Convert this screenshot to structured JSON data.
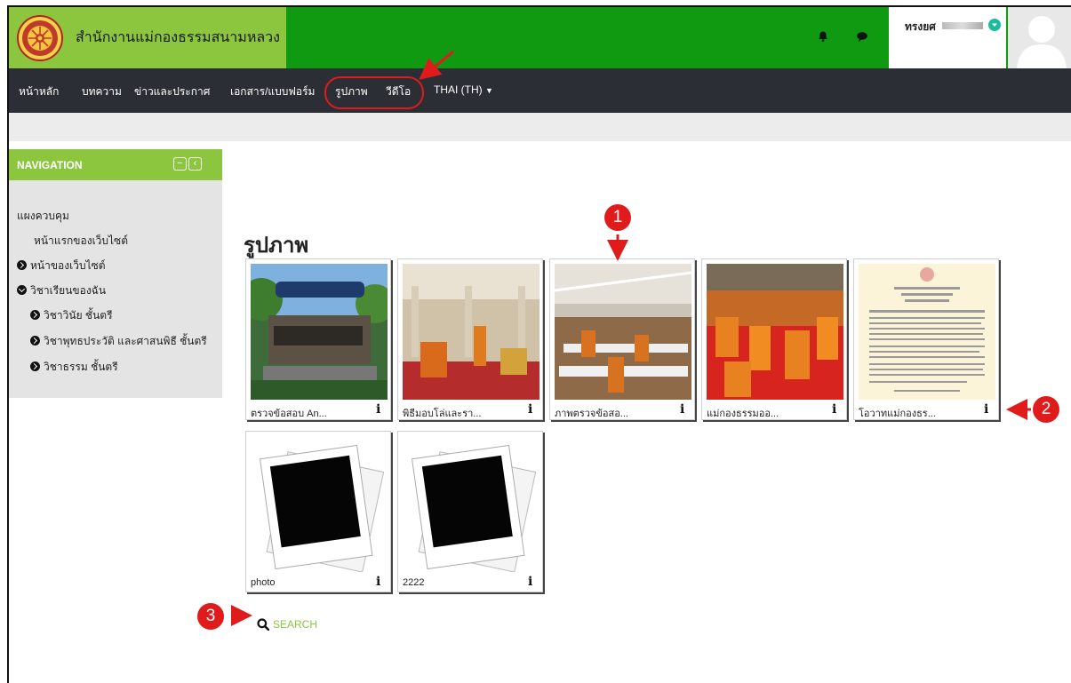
{
  "header": {
    "site_title": "สำนักงานแม่กองธรรมสนามหลวง",
    "user_name": "ทรงยศ",
    "colors": {
      "brand_green": "#8cc63f",
      "header_green": "#0f9a12",
      "navbar": "#2b2f35"
    },
    "icons": [
      "seal-logo-icon",
      "bell-icon",
      "chat-icon",
      "user-status-icon",
      "avatar-icon"
    ]
  },
  "nav": {
    "items": [
      "หน้าหลัก",
      "บทความ",
      "ข่าวและประกาศ",
      "เอกสาร/แบบฟอร์ม",
      "รูปภาพ",
      "วีดีโอ",
      "THAI (TH)"
    ]
  },
  "sidebar": {
    "title": "NAVIGATION",
    "items": [
      "แผงควบคุม",
      "หน้าแรกของเว็บไซต์",
      "หน้าของเว็บไซต์",
      "วิชาเรียนของฉัน",
      "วิชาวินัย ชั้นตรี",
      "วิชาพุทธประวัติ และศาสนพิธี ชั้นตรี",
      "วิชาธรรม ชั้นตรี"
    ]
  },
  "main": {
    "page_title": "รูปภาพ",
    "gallery": [
      {
        "caption": "ตรวจข้อสอบ An...",
        "info": "i"
      },
      {
        "caption": "พิธีมอบโล่และรา...",
        "info": "i"
      },
      {
        "caption": "ภาพตรวจข้อสอ...",
        "info": "i"
      },
      {
        "caption": "แม่กองธรรมออ...",
        "info": "i"
      },
      {
        "caption": "โอวาทแม่กองธร...",
        "info": "i"
      },
      {
        "caption": "photo",
        "info": "i"
      },
      {
        "caption": "2222",
        "info": "i"
      }
    ],
    "search_label": "SEARCH"
  },
  "annotations": [
    "1",
    "2",
    "3"
  ]
}
